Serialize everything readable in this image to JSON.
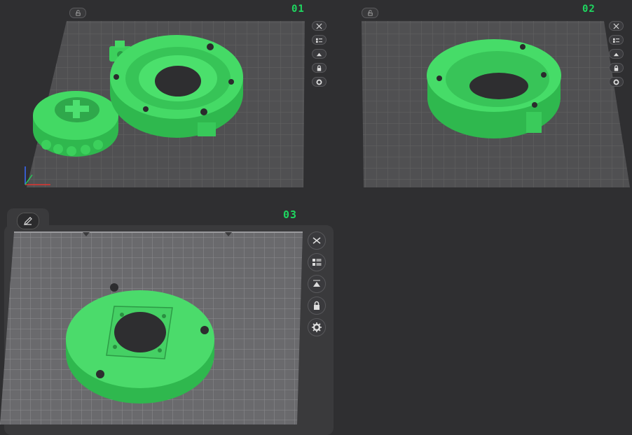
{
  "plates": [
    {
      "id": "plate-1",
      "number": "01"
    },
    {
      "id": "plate-2",
      "number": "02"
    },
    {
      "id": "plate-3",
      "number": "03"
    }
  ],
  "toolbar_icons": [
    "arrange-icon",
    "object-list-icon",
    "slice-icon",
    "lock-icon",
    "settings-icon"
  ],
  "colors": {
    "background": "#2f2f31",
    "plate_surface": "#5a5a5c",
    "grid_line": "#6e6e71",
    "model_green": "#3ed95f",
    "plate_label": "#1ed760"
  }
}
